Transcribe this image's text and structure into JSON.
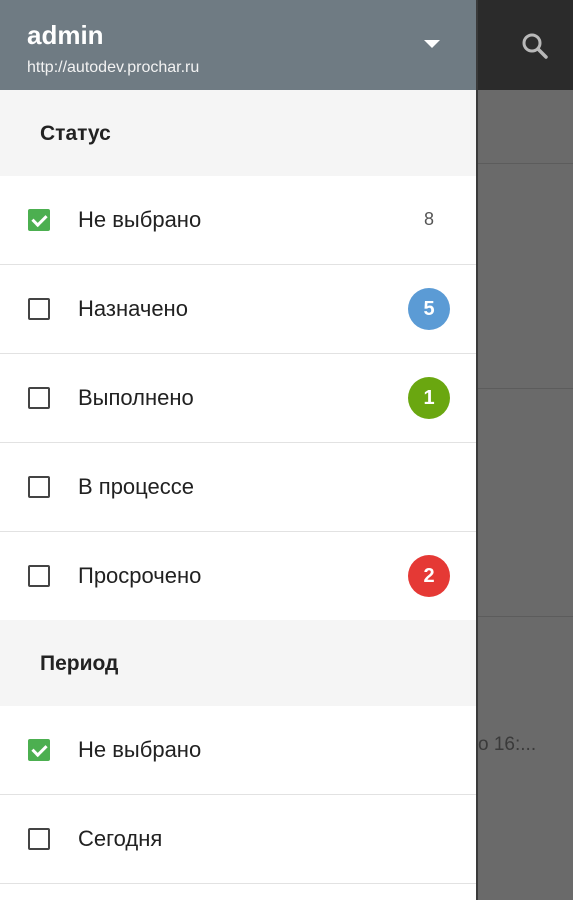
{
  "account": {
    "name": "admin",
    "url": "http://autodev.prochar.ru"
  },
  "background": {
    "snippet_text": "о 16:..."
  },
  "sections": [
    {
      "title": "Статус",
      "items": [
        {
          "label": "Не выбрано",
          "checked": true,
          "count": "8",
          "count_style": "plain"
        },
        {
          "label": "Назначено",
          "checked": false,
          "count": "5",
          "count_style": "badge",
          "badge_color": "#5b9bd5"
        },
        {
          "label": "Выполнено",
          "checked": false,
          "count": "1",
          "count_style": "badge",
          "badge_color": "#6aa710"
        },
        {
          "label": "В процессе",
          "checked": false,
          "count": "",
          "count_style": "none"
        },
        {
          "label": "Просрочено",
          "checked": false,
          "count": "2",
          "count_style": "badge",
          "badge_color": "#e53935"
        }
      ]
    },
    {
      "title": "Период",
      "items": [
        {
          "label": "Не выбрано",
          "checked": true,
          "count": "",
          "count_style": "none"
        },
        {
          "label": "Сегодня",
          "checked": false,
          "count": "",
          "count_style": "none"
        }
      ]
    }
  ],
  "colors": {
    "header_bg": "#6f7b83",
    "check_green": "#4caf50",
    "section_bg": "#f5f5f5"
  }
}
